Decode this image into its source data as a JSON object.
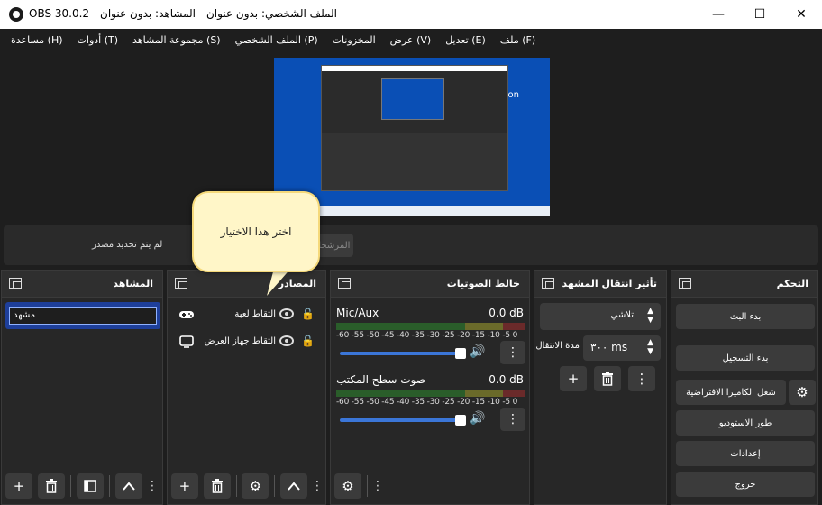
{
  "window": {
    "title": "OBS 30.0.2 - الملف الشخصي: بدون عنوان - المشاهد: بدون عنوان",
    "minimize": "—",
    "maximize": "☐",
    "close": "✕"
  },
  "menu": [
    "ملف (F)",
    "تعديل (E)",
    "عرض (V)",
    "المخزونات",
    "الملف الشخصي (P)",
    "مجموعة المشاهد (S)",
    "أدوات (T)",
    "مساعدة (H)"
  ],
  "preview": {
    "side_text": "on"
  },
  "source_bar": {
    "no_source": "لم يتم تحديد مصدر",
    "filters_button": "المرشحات"
  },
  "callout": {
    "text": "اختر هذا الاختيار"
  },
  "scenes": {
    "title": "المشاهد",
    "items": [
      "مشهد"
    ]
  },
  "sources": {
    "title": "المصادر",
    "items": [
      {
        "label": "التقاط لعبة",
        "icon": "gamepad-icon"
      },
      {
        "label": "التقاط جهاز العرض",
        "icon": "monitor-icon"
      }
    ]
  },
  "mixer": {
    "title": "خالط الصوتيات",
    "ticks": "-60 -55 -50 -45 -40 -35 -30 -25 -20 -15 -10 -5 0",
    "channels": [
      {
        "name": "Mic/Aux",
        "db": "0.0 dB",
        "volume_percent": 100
      },
      {
        "name": "صوت سطح المكتب",
        "db": "0.0 dB",
        "volume_percent": 100
      }
    ]
  },
  "transitions": {
    "title": "تأثير انتقال المشهد",
    "selected": "تلاشي",
    "duration_label": "مدة الانتقال",
    "duration_value": "٣٠٠ ms"
  },
  "controls": {
    "title": "التحكم",
    "start_stream": "بدء البث",
    "start_recording": "بدء التسجيل",
    "virtual_camera": "شغل الكاميرا الافتراضية",
    "studio_mode": "طور الاستوديو",
    "settings": "إعدادات",
    "exit": "خروج"
  },
  "colors": {
    "accent": "#1e3f9a",
    "slider": "#3b76d8",
    "callout_bg": "#fff6c8"
  }
}
